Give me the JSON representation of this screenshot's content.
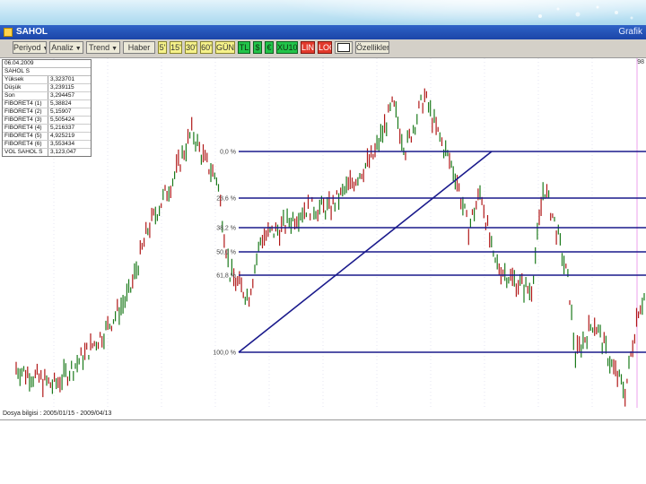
{
  "window": {
    "title": "SAHOL",
    "right_label": "Grafik"
  },
  "toolbar": {
    "buttons": [
      {
        "label": "Periyod",
        "dropdown": true,
        "style": "normal"
      },
      {
        "label": "Analiz",
        "dropdown": true,
        "style": "normal"
      },
      {
        "label": "Trend",
        "dropdown": true,
        "style": "normal"
      },
      {
        "label": "Haber",
        "dropdown": false,
        "style": "normal"
      },
      {
        "label": "5'",
        "dropdown": false,
        "style": "period"
      },
      {
        "label": "15'",
        "dropdown": false,
        "style": "period"
      },
      {
        "label": "30'",
        "dropdown": false,
        "style": "period"
      },
      {
        "label": "60'",
        "dropdown": false,
        "style": "period"
      },
      {
        "label": "GÜN",
        "dropdown": false,
        "style": "period"
      },
      {
        "label": "TL",
        "dropdown": false,
        "style": "green"
      },
      {
        "label": "$",
        "dropdown": false,
        "style": "green"
      },
      {
        "label": "€",
        "dropdown": false,
        "style": "green"
      },
      {
        "label": "XU100",
        "dropdown": false,
        "style": "green"
      },
      {
        "label": "LIN",
        "dropdown": false,
        "style": "red"
      },
      {
        "label": "LOG",
        "dropdown": false,
        "style": "red"
      },
      {
        "label": "",
        "dropdown": false,
        "style": "icon"
      },
      {
        "label": "Özellikler",
        "dropdown": false,
        "style": "normal"
      }
    ]
  },
  "info_panel": {
    "date": "06.04.2009",
    "symbol": "SAHOL S",
    "rows": [
      {
        "label": "Yüksek",
        "value": "3,323701"
      },
      {
        "label": "Düşük",
        "value": "3,239115"
      },
      {
        "label": "Son",
        "value": "3,294457"
      },
      {
        "label": "FIBORET4 (1)",
        "value": "5,38824"
      },
      {
        "label": "FIBORET4 (2)",
        "value": "5,15907"
      },
      {
        "label": "FIBORET4 (3)",
        "value": "5,505424"
      },
      {
        "label": "FIBORET4 (4)",
        "value": "5,216337"
      },
      {
        "label": "FIBORET4 (5)",
        "value": "4,925219"
      },
      {
        "label": "FIBORET4 (6)",
        "value": "3,553434"
      },
      {
        "label": "VOL SAHOL S",
        "value": "3,123,047"
      }
    ]
  },
  "chart": {
    "right_axis_label": "98",
    "footer": "Dosya bilgisi : 2005/01/15 - 2009/04/13",
    "fib_levels": [
      {
        "label": "0,0 %"
      },
      {
        "label": "23,6 %"
      },
      {
        "label": "38,2 %"
      },
      {
        "label": "50,0 %"
      },
      {
        "label": "61,8 %"
      },
      {
        "label": "100,0 %"
      }
    ],
    "colors": {
      "up": "#1b7a1b",
      "down": "#b01818",
      "fib_line": "#1a1a8c",
      "grid": "#c9c9e6"
    }
  },
  "chart_data": {
    "type": "line",
    "description_series": "daily OHLC bars",
    "fib_levels_pct": [
      0.0,
      23.6,
      38.2,
      50.0,
      61.8,
      100.0
    ],
    "points": [
      {
        "t": 0,
        "v": 0.08
      },
      {
        "t": 0.06,
        "v": 0.02
      },
      {
        "t": 0.09,
        "v": 0.08
      },
      {
        "t": 0.14,
        "v": 0.2
      },
      {
        "t": 0.18,
        "v": 0.33
      },
      {
        "t": 0.21,
        "v": 0.55
      },
      {
        "t": 0.25,
        "v": 0.72
      },
      {
        "t": 0.28,
        "v": 0.88
      },
      {
        "t": 0.3,
        "v": 0.78
      },
      {
        "t": 0.32,
        "v": 0.72
      },
      {
        "t": 0.34,
        "v": 0.4
      },
      {
        "t": 0.37,
        "v": 0.32
      },
      {
        "t": 0.39,
        "v": 0.52
      },
      {
        "t": 0.42,
        "v": 0.55
      },
      {
        "t": 0.46,
        "v": 0.62
      },
      {
        "t": 0.5,
        "v": 0.62
      },
      {
        "t": 0.54,
        "v": 0.72
      },
      {
        "t": 0.57,
        "v": 0.8
      },
      {
        "t": 0.6,
        "v": 0.97
      },
      {
        "t": 0.62,
        "v": 0.82
      },
      {
        "t": 0.65,
        "v": 1.0
      },
      {
        "t": 0.67,
        "v": 0.88
      },
      {
        "t": 0.7,
        "v": 0.73
      },
      {
        "t": 0.72,
        "v": 0.55
      },
      {
        "t": 0.74,
        "v": 0.68
      },
      {
        "t": 0.76,
        "v": 0.44
      },
      {
        "t": 0.79,
        "v": 0.38
      },
      {
        "t": 0.82,
        "v": 0.34
      },
      {
        "t": 0.84,
        "v": 0.7
      },
      {
        "t": 0.86,
        "v": 0.55
      },
      {
        "t": 0.88,
        "v": 0.36
      },
      {
        "t": 0.89,
        "v": 0.12
      },
      {
        "t": 0.92,
        "v": 0.24
      },
      {
        "t": 0.95,
        "v": 0.08
      },
      {
        "t": 0.97,
        "v": 0.0
      },
      {
        "t": 0.99,
        "v": 0.28
      },
      {
        "t": 1.0,
        "v": 0.32
      }
    ]
  }
}
